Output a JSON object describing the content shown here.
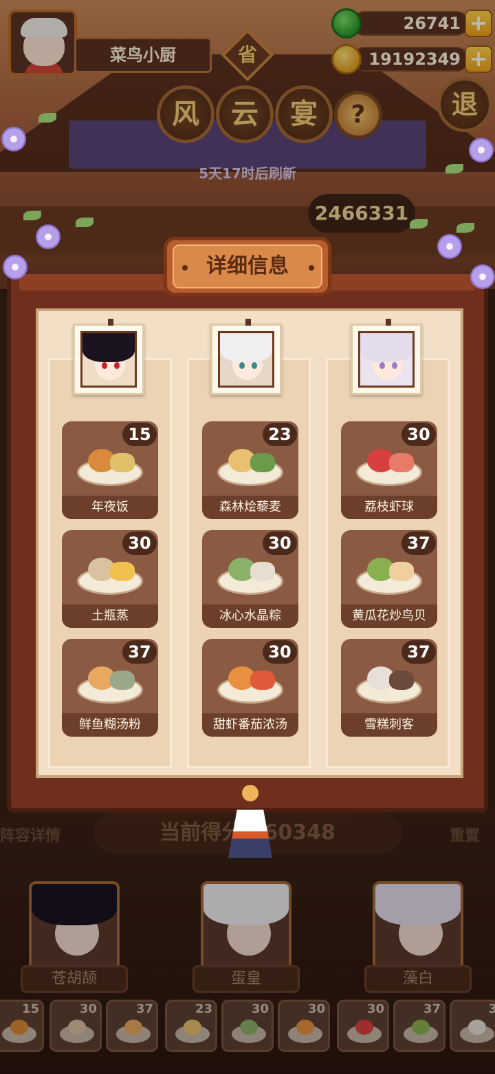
{
  "player": {
    "name": "菜鸟小厨",
    "badge": "省"
  },
  "currency": {
    "jade": "26741",
    "coins": "19192349",
    "add_label": "+"
  },
  "event": {
    "title_chars": [
      "风",
      "云",
      "宴"
    ],
    "help": "?",
    "exit": "退",
    "refresh_text": "5天17时后刷新",
    "score_peek": "2466331"
  },
  "modal": {
    "title": "详细信息",
    "columns": [
      {
        "hair_color": "#1b1320",
        "eye_color": "#c8202a",
        "dishes": [
          {
            "name": "年夜饭",
            "score": "15",
            "food_colors": [
              "#d98a3a",
              "#e0c06a"
            ]
          },
          {
            "name": "土瓶蒸",
            "score": "30",
            "food_colors": [
              "#d8c2a0",
              "#f0c050"
            ]
          },
          {
            "name": "鲜鱼糊汤粉",
            "score": "37",
            "food_colors": [
              "#e8a860",
              "#9aa88a"
            ]
          }
        ]
      },
      {
        "hair_color": "#f0eef0",
        "eye_color": "#3a8a8a",
        "dishes": [
          {
            "name": "森林烩藜麦",
            "score": "23",
            "food_colors": [
              "#e8c070",
              "#6a9a4a"
            ]
          },
          {
            "name": "冰心水晶粽",
            "score": "30",
            "food_colors": [
              "#8ab06a",
              "#e8ded0"
            ]
          },
          {
            "name": "甜虾番茄浓汤",
            "score": "30",
            "food_colors": [
              "#e89040",
              "#e05a3a"
            ]
          }
        ]
      },
      {
        "hair_color": "#e4dcec",
        "eye_color": "#9a7ac0",
        "dishes": [
          {
            "name": "荔枝虾球",
            "score": "30",
            "food_colors": [
              "#d84040",
              "#e87a6a"
            ]
          },
          {
            "name": "黄瓜花炒鸟贝",
            "score": "37",
            "food_colors": [
              "#8ab050",
              "#f0d0a0"
            ]
          },
          {
            "name": "雪糕刺客",
            "score": "37",
            "food_colors": [
              "#e8e0d8",
              "#6a4a3a"
            ]
          }
        ]
      }
    ]
  },
  "background": {
    "score_label": "当前得分",
    "score_value": "160348",
    "left_tag": "阵容详情",
    "right_tag": "重置",
    "characters": [
      "苍胡颉",
      "蛋皇",
      "藻白"
    ],
    "thumb_scores": [
      "15",
      "30",
      "37",
      "23",
      "30",
      "30",
      "30",
      "37",
      "3"
    ]
  }
}
